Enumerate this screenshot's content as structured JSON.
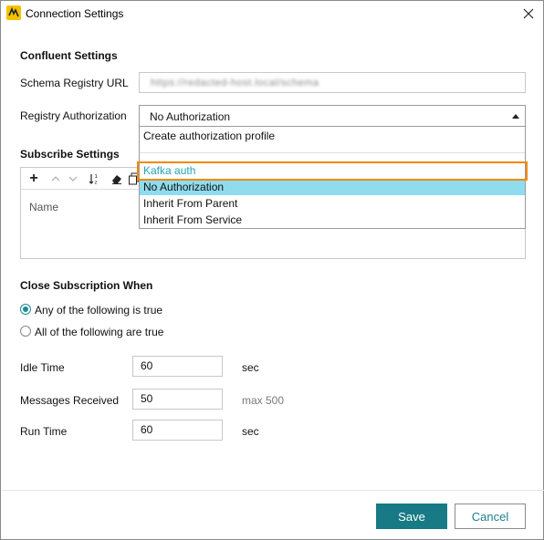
{
  "window": {
    "title": "Connection Settings",
    "icons": {
      "app": "app-logo-icon",
      "close": "close-icon"
    }
  },
  "confluent": {
    "section_title": "Confluent Settings",
    "schema_registry_label": "Schema Registry URL",
    "schema_registry_value": "https://redacted-host.local/schema",
    "registry_auth_label": "Registry Authorization",
    "registry_auth_value": "No Authorization"
  },
  "subscribe": {
    "section_title": "Subscribe Settings",
    "toolbar_icons": [
      "add-icon",
      "move-up-icon",
      "move-down-icon",
      "sort-icon",
      "eraser-icon",
      "copy-icon"
    ],
    "column_header": "Name"
  },
  "auth_dropdown": {
    "items": [
      {
        "label": "Create authorization profile"
      },
      {
        "label": "Kafka auth"
      },
      {
        "label": "No Authorization"
      },
      {
        "label": "Inherit From Parent"
      },
      {
        "label": "Inherit From Service"
      }
    ],
    "selected": "No Authorization",
    "highlighted": "Kafka auth"
  },
  "close_subscription": {
    "section_title": "Close Subscription When",
    "options": [
      {
        "label": "Any of the following is true",
        "checked": true
      },
      {
        "label": "All of the following are true",
        "checked": false
      }
    ],
    "idle_time_label": "Idle Time",
    "idle_time_value": "60",
    "idle_time_unit": "sec",
    "messages_received_label": "Messages Received",
    "messages_received_value": "50",
    "messages_received_hint": "max 500",
    "run_time_label": "Run Time",
    "run_time_value": "60",
    "run_time_unit": "sec"
  },
  "footer": {
    "save_label": "Save",
    "cancel_label": "Cancel"
  },
  "colors": {
    "accent": "#177a84",
    "selection": "#8fdcef",
    "highlight_border": "#f08a00",
    "kafka_text": "#23a3b8"
  }
}
